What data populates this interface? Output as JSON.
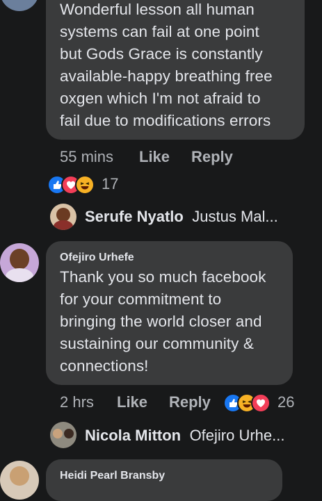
{
  "comments": [
    {
      "text_lines": [
        "Wonderful lesson all human",
        "systems can fail at one point",
        "but Gods Grace is constantly",
        "available-happy breathing free",
        "oxgen which I'm not afraid to",
        "fail due to modifications errors"
      ],
      "time": "55 mins",
      "like_label": "Like",
      "reply_label": "Reply",
      "reaction_count": "17",
      "reactions": [
        "like-icon",
        "love-icon",
        "haha-icon"
      ],
      "reply_preview": {
        "name": "Serufe Nyatlo",
        "snippet": "Justus Mal..."
      }
    },
    {
      "author": "Ofejiro Urhefe",
      "text_lines": [
        "Thank you so much facebook",
        "for your commitment to",
        "bringing the world closer and",
        "sustaining our community &",
        "connections!"
      ],
      "time": "2 hrs",
      "like_label": "Like",
      "reply_label": "Reply",
      "reaction_count": "26",
      "reactions": [
        "like-icon",
        "haha-icon",
        "love-icon"
      ],
      "reply_preview": {
        "name": "Nicola Mitton",
        "snippet": "Ofejiro Urhe..."
      }
    },
    {
      "author": "Heidi Pearl Bransby"
    }
  ],
  "colors": {
    "background": "#18191a",
    "bubble": "#3a3b3c",
    "text": "#e4e6eb",
    "secondary": "#b0b3b8",
    "like_blue": "#1877f2",
    "love_red": "#f33e58",
    "haha_yellow": "#f7b125"
  }
}
